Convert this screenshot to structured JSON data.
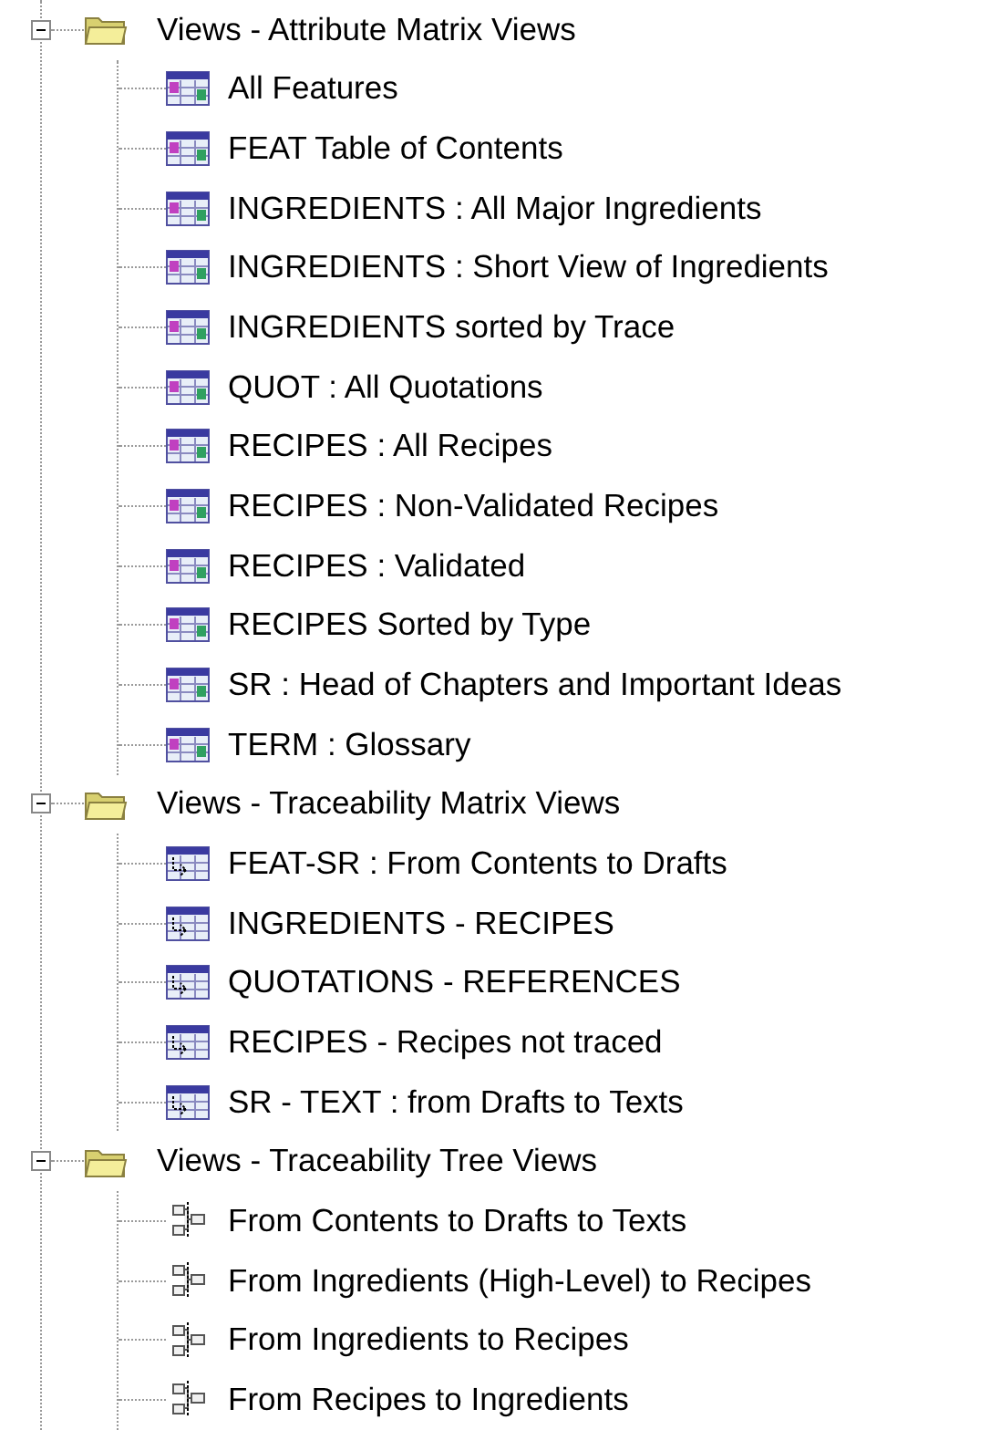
{
  "groups": [
    {
      "label": "Views - Attribute Matrix Views",
      "expanded": true,
      "children": [
        {
          "label": "All Features",
          "kind": "attribute"
        },
        {
          "label": "FEAT Table of Contents",
          "kind": "attribute"
        },
        {
          "label": "INGREDIENTS : All Major Ingredients",
          "kind": "attribute"
        },
        {
          "label": "INGREDIENTS : Short View of Ingredients",
          "kind": "attribute"
        },
        {
          "label": "INGREDIENTS sorted by Trace",
          "kind": "attribute"
        },
        {
          "label": "QUOT : All Quotations",
          "kind": "attribute"
        },
        {
          "label": "RECIPES : All Recipes",
          "kind": "attribute"
        },
        {
          "label": "RECIPES : Non-Validated Recipes",
          "kind": "attribute"
        },
        {
          "label": "RECIPES : Validated",
          "kind": "attribute"
        },
        {
          "label": "RECIPES Sorted by Type",
          "kind": "attribute"
        },
        {
          "label": "SR : Head of Chapters and Important Ideas",
          "kind": "attribute"
        },
        {
          "label": "TERM : Glossary",
          "kind": "attribute"
        }
      ]
    },
    {
      "label": "Views - Traceability Matrix Views",
      "expanded": true,
      "children": [
        {
          "label": "FEAT-SR : From Contents to Drafts",
          "kind": "traceability"
        },
        {
          "label": "INGREDIENTS - RECIPES",
          "kind": "traceability"
        },
        {
          "label": "QUOTATIONS - REFERENCES",
          "kind": "traceability"
        },
        {
          "label": "RECIPES - Recipes not traced",
          "kind": "traceability"
        },
        {
          "label": "SR - TEXT : from Drafts to Texts",
          "kind": "traceability"
        }
      ]
    },
    {
      "label": "Views - Traceability Tree Views",
      "expanded": true,
      "children": [
        {
          "label": "From Contents to Drafts to Texts",
          "kind": "tree"
        },
        {
          "label": "From Ingredients (High-Level) to Recipes",
          "kind": "tree"
        },
        {
          "label": "From Ingredients to Recipes",
          "kind": "tree"
        },
        {
          "label": "From Recipes to Ingredients",
          "kind": "tree"
        }
      ]
    }
  ]
}
